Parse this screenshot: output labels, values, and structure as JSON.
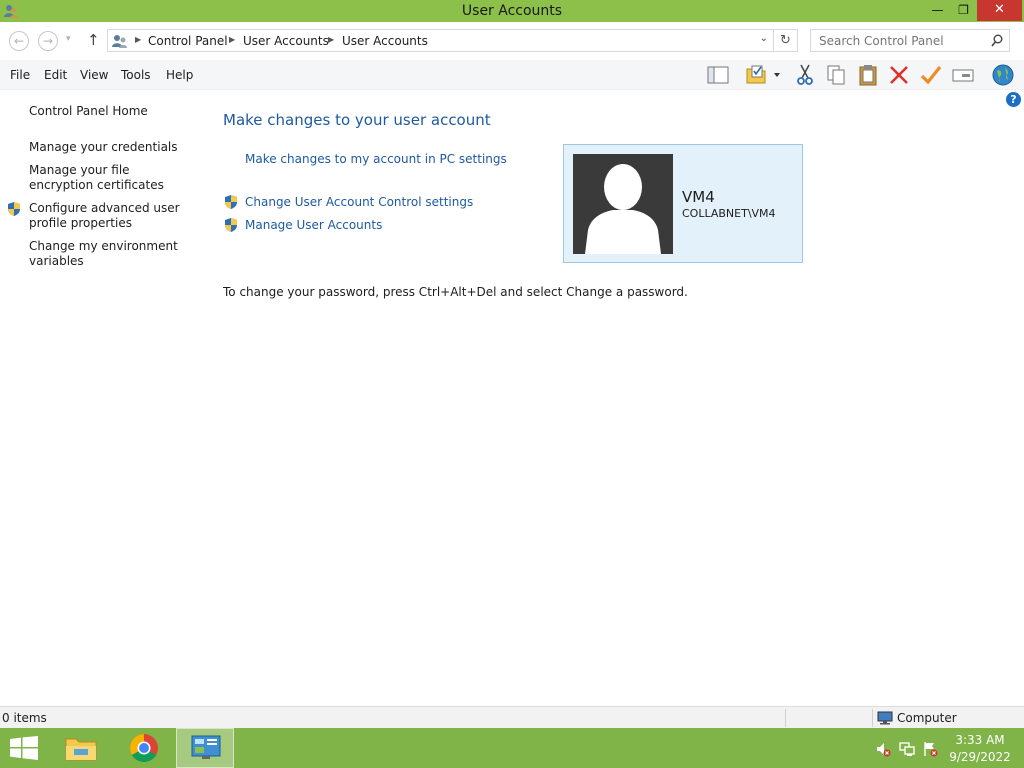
{
  "window": {
    "title": "User Accounts",
    "controls": {
      "minimize": "—",
      "maximize": "❐",
      "close": "✕"
    }
  },
  "navigation": {
    "back": "←",
    "forward": "→",
    "recent": "▾",
    "up": "↑",
    "breadcrumbs": [
      "Control Panel",
      "User Accounts",
      "User Accounts"
    ],
    "search_placeholder": "Search Control Panel"
  },
  "menu": [
    "File",
    "Edit",
    "View",
    "Tools",
    "Help"
  ],
  "toolbar": [
    "layout-pane-icon",
    "folder-checkmark-icon",
    "dropdown-arrow-icon",
    "cut-icon",
    "copy-icon",
    "paste-icon",
    "delete-icon",
    "check-icon",
    "properties-icon",
    "globe-icon"
  ],
  "help": "?",
  "sidebar": {
    "items": [
      {
        "label": "Control Panel Home",
        "shield": false
      },
      {
        "label": "Manage your credentials",
        "shield": false
      },
      {
        "label": "Manage your file encryption certificates",
        "shield": false
      },
      {
        "label": "Configure advanced user profile properties",
        "shield": true
      },
      {
        "label": "Change my environment variables",
        "shield": false
      }
    ]
  },
  "main": {
    "title": "Make changes to your user account",
    "links": [
      {
        "label": "Make changes to my account in PC settings",
        "shield": false
      },
      {
        "label": "Change User Account Control settings",
        "shield": true
      },
      {
        "label": "Manage User Accounts",
        "shield": true
      }
    ],
    "password_note": "To change your password, press Ctrl+Alt+Del and select Change a password."
  },
  "user": {
    "name": "VM4",
    "domain": "COLLABNET\\VM4"
  },
  "statusbar": {
    "items": "0 items",
    "zone": "Computer"
  },
  "taskbar": {
    "apps": [
      "windows-start-icon",
      "file-explorer-icon",
      "chrome-icon",
      "control-panel-icon"
    ],
    "tray": [
      "speaker-muted-icon",
      "network-icon",
      "action-center-icon"
    ],
    "clock": {
      "time": "3:33 AM",
      "date": "9/29/2022"
    }
  },
  "colors": {
    "titlebar": "#8cc04b",
    "taskbar": "#80b448",
    "link": "#1e5aa0",
    "close_button": "#c7372f",
    "user_tile": "#e3f1fa"
  }
}
